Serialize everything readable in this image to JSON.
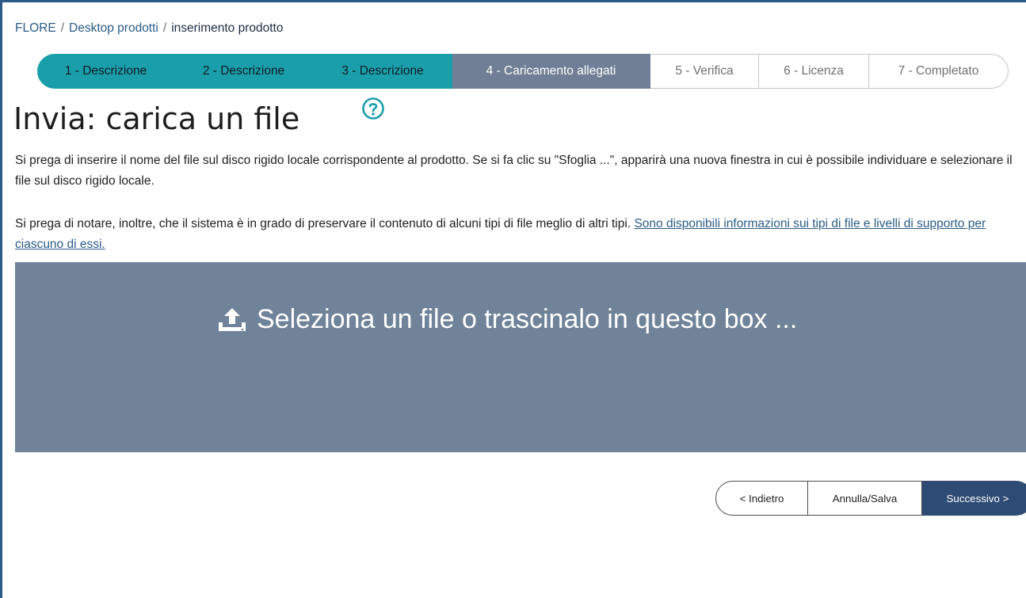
{
  "breadcrumb": {
    "items": [
      "FLORE",
      "Desktop prodotti"
    ],
    "separator": "/",
    "current": "inserimento prodotto"
  },
  "stepper": {
    "steps": [
      {
        "label": "1 - Descrizione",
        "state": "done"
      },
      {
        "label": "2 - Descrizione",
        "state": "done"
      },
      {
        "label": "3 - Descrizione",
        "state": "done"
      },
      {
        "label": "4 - Caricamento allegati",
        "state": "current"
      },
      {
        "label": "5 - Verifica",
        "state": "todo"
      },
      {
        "label": "6 - Licenza",
        "state": "todo"
      },
      {
        "label": "7 - Completato",
        "state": "todo"
      }
    ]
  },
  "page": {
    "title": "Invia: carica un file",
    "help_icon": "question-circle-icon",
    "intro": "Si prega di inserire il nome del file sul disco rigido locale corrispondente al prodotto. Se si fa clic su \"Sfoglia ...\", apparirà una nuova finestra in cui è possibile individuare e selezionare il file sul disco rigido locale.",
    "note_prefix": "Si prega di notare, inoltre, che il sistema è in grado di preservare il contenuto di alcuni tipi di file meglio di altri tipi.",
    "note_link": "Sono disponibili informazioni sui tipi di file e livelli di supporto per ciascuno di essi."
  },
  "dropzone": {
    "icon": "upload-icon",
    "label": "Seleziona un file o trascinalo in questo box ..."
  },
  "actions": {
    "back": "< Indietro",
    "save": "Annulla/Salva",
    "next": "Successivo >"
  },
  "colors": {
    "step_done": "#1a9faa",
    "step_current": "#707f96",
    "dropzone_bg": "#708399",
    "primary_button": "#2d4b73",
    "link": "#2b5b86"
  }
}
